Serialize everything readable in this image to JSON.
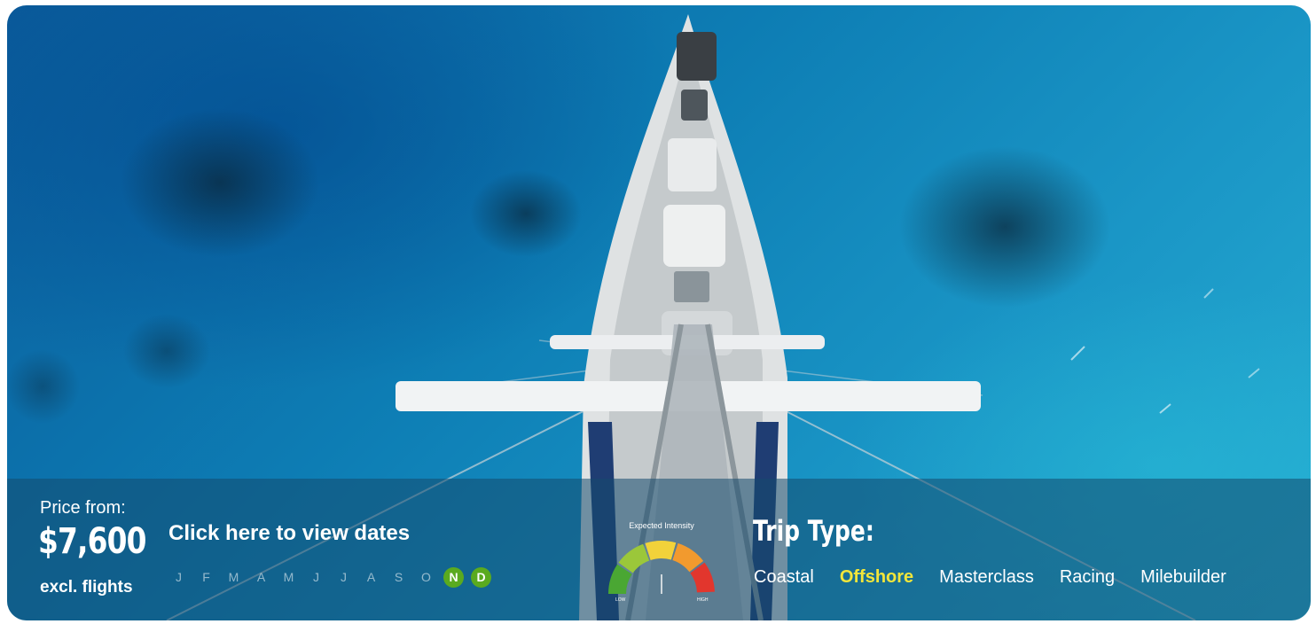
{
  "price": {
    "label": "Price from:",
    "value": "$7,600",
    "note": "excl. flights"
  },
  "dates_link": "Click here to view dates",
  "months": [
    {
      "letter": "J",
      "active": false
    },
    {
      "letter": "F",
      "active": false
    },
    {
      "letter": "M",
      "active": false
    },
    {
      "letter": "A",
      "active": false
    },
    {
      "letter": "M",
      "active": false
    },
    {
      "letter": "J",
      "active": false
    },
    {
      "letter": "J",
      "active": false
    },
    {
      "letter": "A",
      "active": false
    },
    {
      "letter": "S",
      "active": false
    },
    {
      "letter": "O",
      "active": false
    },
    {
      "letter": "N",
      "active": true
    },
    {
      "letter": "D",
      "active": true
    }
  ],
  "intensity": {
    "title": "Expected Intensity",
    "low_label": "LOW",
    "high_label": "HIGH",
    "segment_colors": [
      "#4aa733",
      "#9bc73a",
      "#f2d23a",
      "#f29a2e",
      "#e2362d"
    ]
  },
  "trip_type": {
    "title": "Trip Type:",
    "options": [
      {
        "label": "Coastal",
        "active": false
      },
      {
        "label": "Offshore",
        "active": true
      },
      {
        "label": "Masterclass",
        "active": false
      },
      {
        "label": "Racing",
        "active": false
      },
      {
        "label": "Milebuilder",
        "active": false
      }
    ]
  },
  "colors": {
    "active_month": "#5aaa1f",
    "active_trip": "#f2e63a"
  },
  "image": {
    "alt_icon": "sailboat-aerial-photo"
  }
}
